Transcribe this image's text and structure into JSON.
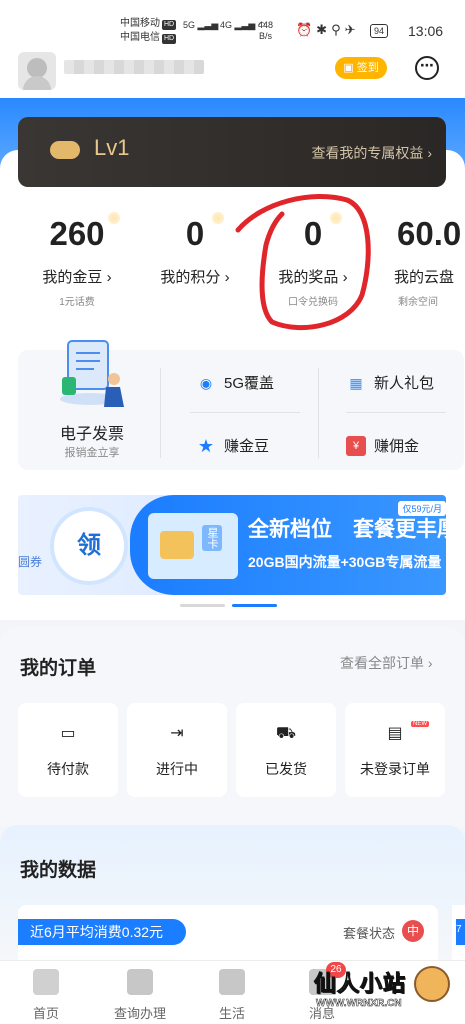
{
  "status_bar": {
    "carrier1": "中国移动",
    "carrier2": "中国电信",
    "hd": "HD",
    "sig1": "5G",
    "sig2": "4G",
    "net_speed_value": "448",
    "net_speed_unit": "B/s",
    "battery": "94",
    "time": "13:06"
  },
  "header": {
    "checkin_label": "签到"
  },
  "level_card": {
    "level": "Lv1",
    "benefits_link": "查看我的专属权益 ›"
  },
  "stats": [
    {
      "value": "260",
      "label": "我的金豆 ›",
      "sub": "1元话费"
    },
    {
      "value": "0",
      "label": "我的积分 ›",
      "sub": ""
    },
    {
      "value": "0",
      "label": "我的奖品 ›",
      "sub": "口令兑换码"
    },
    {
      "value": "60.0",
      "label": "我的云盘",
      "sub": "剩余空间"
    }
  ],
  "services": {
    "invoice_title": "电子发票",
    "invoice_sub": "报销金立享",
    "coverage": "5G覆盖",
    "newbie_gift": "新人礼包",
    "earn_beans": "赚金豆",
    "earn_commission": "赚佣金"
  },
  "banner": {
    "voucher": "圆券",
    "claim": "领",
    "sim_label": "星卡",
    "title": "全新档位　套餐更丰厚",
    "subtitle": "20GB国内流量+30GB专属流量",
    "price_badge": "仅59元/月"
  },
  "orders": {
    "title": "我的订单",
    "view_all": "查看全部订单 ›",
    "items": [
      {
        "label": "待付款"
      },
      {
        "label": "进行中"
      },
      {
        "label": "已发货"
      },
      {
        "label": "未登录订单"
      }
    ],
    "new_tag": "NEW"
  },
  "my_data": {
    "title": "我的数据",
    "avg_spend": "近6月平均消费0.32元",
    "package_status": "套餐状态",
    "package_badge": "中",
    "edge_tag": "7"
  },
  "tabbar": {
    "items": [
      {
        "label": "首页"
      },
      {
        "label": "查询办理"
      },
      {
        "label": "生活"
      },
      {
        "label": "消息"
      }
    ],
    "message_badge": "26"
  },
  "watermark": {
    "title": "仙人小站",
    "url": "WWW.WRNXR.CN"
  }
}
